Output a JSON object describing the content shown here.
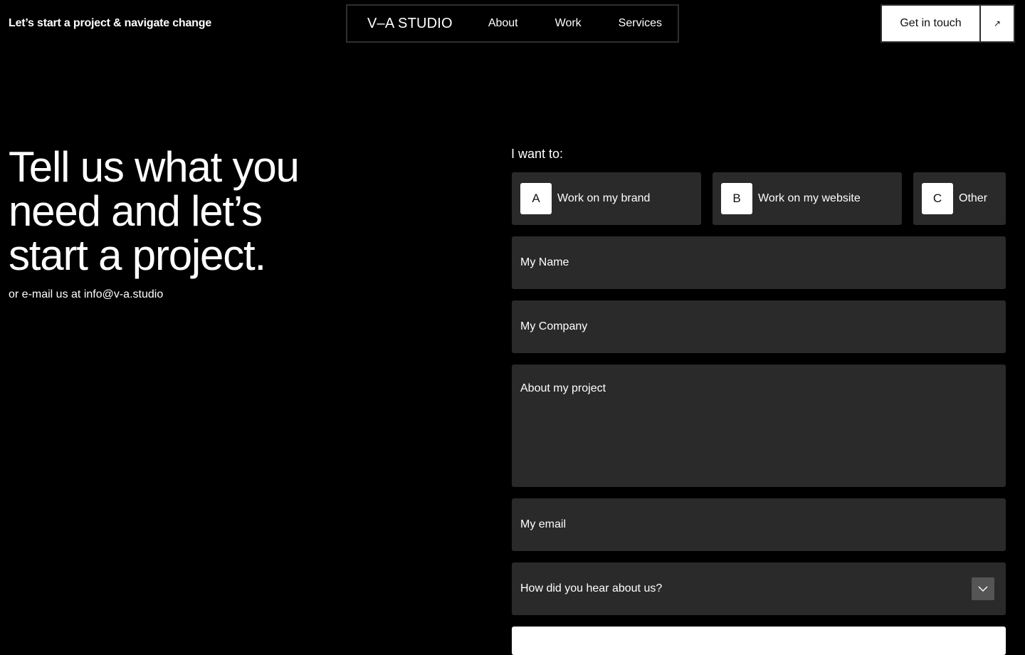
{
  "header": {
    "tagline": "Let’s start a project & navigate change",
    "logo": "V–A STUDIO",
    "nav": {
      "about": "About",
      "work": "Work",
      "services": "Services"
    },
    "cta": {
      "label": "Get in touch",
      "icon": "arrow-up-right-icon",
      "arrow_glyph": "↗"
    }
  },
  "hero": {
    "title_lines": [
      "Tell us what you",
      "need and let’s",
      "start a project."
    ],
    "email_line": "or e-mail us at info@v-a.studio"
  },
  "form": {
    "label": "I want to:",
    "options": [
      {
        "key": "A",
        "label": "Work on my brand"
      },
      {
        "key": "B",
        "label": "Work on my website"
      },
      {
        "key": "C",
        "label": "Other"
      }
    ],
    "name_placeholder": "My Name",
    "company_placeholder": "My Company",
    "project_placeholder": "About my project",
    "email_placeholder": "My email",
    "source_placeholder": "How did you hear about us?",
    "source_icon": "chevron-down-icon"
  },
  "colors": {
    "background": "#000000",
    "field": "#2a2a2a",
    "text": "#ffffff",
    "accent_surface": "#ffffff"
  }
}
